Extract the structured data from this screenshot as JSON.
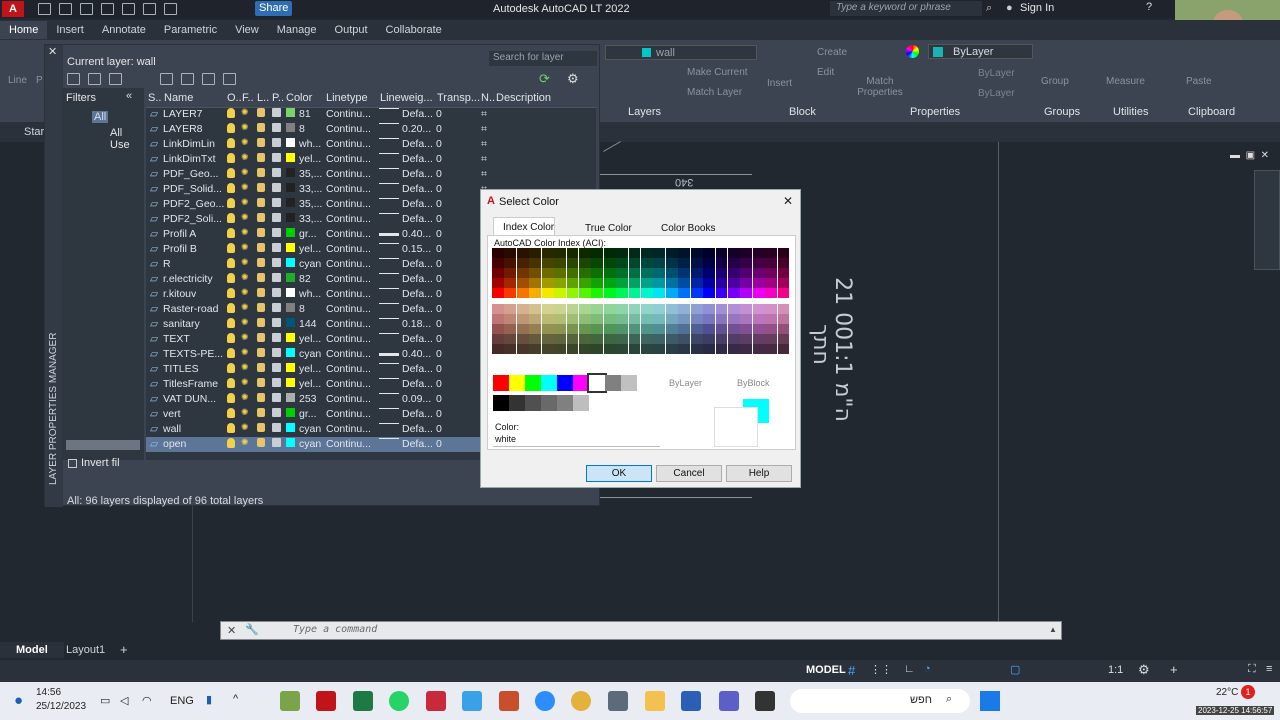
{
  "title_bar": {
    "title": "Autodesk AutoCAD LT 2022",
    "share_label": "Share",
    "search_placeholder": "Type a keyword or phrase",
    "sign_in": "Sign In"
  },
  "ribbon_tabs": [
    "Home",
    "Insert",
    "Annotate",
    "Parametric",
    "View",
    "Manage",
    "Output",
    "Collaborate"
  ],
  "ribbon": {
    "layer_name": "wall",
    "layers_tools": [
      "Make Current",
      "Match Layer"
    ],
    "block_tools": [
      "Insert",
      "Create",
      "Edit"
    ],
    "match_properties": "Match Properties",
    "bylayer_color": "ByLayer",
    "bylayer_linetype": "ByLayer",
    "bylayer_lineweight": "ByLayer",
    "group_label": "Group",
    "measure_label": "Measure",
    "paste_label": "Paste",
    "panels": [
      "Layers",
      "Block",
      "Properties",
      "Groups",
      "Utilities",
      "Clipboard"
    ],
    "left_tools": [
      "Line",
      "P"
    ]
  },
  "file_tab": "Star",
  "lpm": {
    "current_layer": "Current layer: wall",
    "search_placeholder": "Search for layer",
    "filters_label": "Filters",
    "tree_all": "All",
    "tree_all_used": "All Use",
    "invert_filter": "Invert fil",
    "side_title": "LAYER PROPERTIES MANAGER",
    "status": "All: 96 layers displayed of 96 total layers",
    "columns": [
      "S..",
      "Name",
      "O..",
      "F..",
      "L..",
      "P..",
      "Color",
      "Linetype",
      "Lineweig...",
      "Transp...",
      "N..",
      "Description"
    ],
    "rows": [
      {
        "name": "LAYER7",
        "color_text": "81",
        "swatch": "#79d36a",
        "linetype": "Continu...",
        "lineweight": "Defa...",
        "transp": "0",
        "thick": false
      },
      {
        "name": "LAYER8",
        "color_text": "8",
        "swatch": "#808080",
        "linetype": "Continu...",
        "lineweight": "0.20...",
        "transp": "0",
        "thick": false
      },
      {
        "name": "LinkDimLin",
        "color_text": "wh...",
        "swatch": "#ffffff",
        "linetype": "Continu...",
        "lineweight": "Defa...",
        "transp": "0",
        "thick": false
      },
      {
        "name": "LinkDimTxt",
        "color_text": "yel...",
        "swatch": "#ffff00",
        "linetype": "Continu...",
        "lineweight": "Defa...",
        "transp": "0",
        "thick": false
      },
      {
        "name": "PDF_Geo...",
        "color_text": "35,...",
        "swatch": "#222222",
        "linetype": "Continu...",
        "lineweight": "Defa...",
        "transp": "0",
        "thick": false
      },
      {
        "name": "PDF_Solid...",
        "color_text": "33,...",
        "swatch": "#212121",
        "linetype": "Continu...",
        "lineweight": "Defa...",
        "transp": "0",
        "thick": false
      },
      {
        "name": "PDF2_Geo...",
        "color_text": "35,...",
        "swatch": "#222222",
        "linetype": "Continu...",
        "lineweight": "Defa...",
        "transp": "0",
        "thick": false
      },
      {
        "name": "PDF2_Soli...",
        "color_text": "33,...",
        "swatch": "#212121",
        "linetype": "Continu...",
        "lineweight": "Defa...",
        "transp": "0",
        "thick": false
      },
      {
        "name": "Profil A",
        "color_text": "gr...",
        "swatch": "#00d000",
        "linetype": "Continu...",
        "lineweight": "0.40...",
        "transp": "0",
        "thick": true
      },
      {
        "name": "Profil B",
        "color_text": "yel...",
        "swatch": "#ffff00",
        "linetype": "Continu...",
        "lineweight": "0.15...",
        "transp": "0",
        "thick": false
      },
      {
        "name": "R",
        "color_text": "cyan",
        "swatch": "#00ffff",
        "linetype": "Continu...",
        "lineweight": "Defa...",
        "transp": "0",
        "thick": false
      },
      {
        "name": "r.electricity",
        "color_text": "82",
        "swatch": "#1fae2a",
        "linetype": "Continu...",
        "lineweight": "Defa...",
        "transp": "0",
        "thick": false
      },
      {
        "name": "r.kitouv",
        "color_text": "wh...",
        "swatch": "#ffffff",
        "linetype": "Continu...",
        "lineweight": "Defa...",
        "transp": "0",
        "thick": false
      },
      {
        "name": "Raster-road",
        "color_text": "8",
        "swatch": "#808080",
        "linetype": "Continu...",
        "lineweight": "Defa...",
        "transp": "0",
        "thick": false
      },
      {
        "name": "sanitary",
        "color_text": "144",
        "swatch": "#00577a",
        "linetype": "Continu...",
        "lineweight": "0.18...",
        "transp": "0",
        "thick": false
      },
      {
        "name": "TEXT",
        "color_text": "yel...",
        "swatch": "#ffff00",
        "linetype": "Continu...",
        "lineweight": "Defa...",
        "transp": "0",
        "thick": false
      },
      {
        "name": "TEXTS-PE...",
        "color_text": "cyan",
        "swatch": "#00ffff",
        "linetype": "Continu...",
        "lineweight": "0.40...",
        "transp": "0",
        "thick": true
      },
      {
        "name": "TITLES",
        "color_text": "yel...",
        "swatch": "#ffff00",
        "linetype": "Continu...",
        "lineweight": "Defa...",
        "transp": "0",
        "thick": false
      },
      {
        "name": "TitlesFrame",
        "color_text": "yel...",
        "swatch": "#ffff00",
        "linetype": "Continu...",
        "lineweight": "Defa...",
        "transp": "0",
        "thick": false
      },
      {
        "name": "VAT DUN...",
        "color_text": "253",
        "swatch": "#adadad",
        "linetype": "Continu...",
        "lineweight": "0.09...",
        "transp": "0",
        "thick": false
      },
      {
        "name": "vert",
        "color_text": "gr...",
        "swatch": "#00d000",
        "linetype": "Continu...",
        "lineweight": "Defa...",
        "transp": "0",
        "thick": false
      },
      {
        "name": "wall",
        "color_text": "cyan",
        "swatch": "#00ffff",
        "linetype": "Continu...",
        "lineweight": "Defa...",
        "transp": "0",
        "thick": false
      },
      {
        "name": "open",
        "color_text": "cyan",
        "swatch": "#00ffff",
        "linetype": "Continu...",
        "lineweight": "Defa...",
        "transp": "0",
        "thick": false,
        "selected": true
      }
    ]
  },
  "dialog": {
    "title": "Select Color",
    "tabs": [
      "Index Color",
      "True Color",
      "Color Books"
    ],
    "aci_label": "AutoCAD Color Index (ACI):",
    "bylayer": "ByLayer",
    "byblock": "ByBlock",
    "color_label": "Color:",
    "color_value": "white",
    "ok": "OK",
    "cancel": "Cancel",
    "help": "Help",
    "std_colors": [
      "#ff0000",
      "#ffff00",
      "#00ff00",
      "#00ffff",
      "#0000ff",
      "#ff00ff",
      "#ffffff",
      "#808080",
      "#c0c0c0"
    ],
    "gray_colors": [
      "#000000",
      "#333333",
      "#505050",
      "#696969",
      "#808080",
      "#bebebe",
      "#ffffff"
    ]
  },
  "drawing": {
    "dim_text": "340",
    "rot_text_1": "21 ה\"מ 001:1",
    "rot_text_2": "חתך"
  },
  "command_placeholder": "Type a command",
  "layout_tabs": [
    "Model",
    "Layout1"
  ],
  "status": {
    "model": "MODEL",
    "scale": "1:1"
  },
  "taskbar": {
    "time": "14:56",
    "date": "25/12/2023",
    "lang": "ENG",
    "search": "חפש",
    "temp": "22°C",
    "notif": "1",
    "stamp": "2023-12-25 14:56:57"
  }
}
